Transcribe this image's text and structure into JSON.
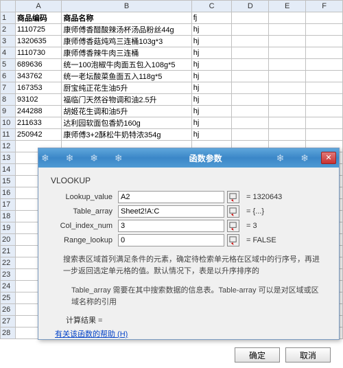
{
  "columns": [
    "",
    "A",
    "B",
    "C",
    "D",
    "E",
    "F"
  ],
  "headers": {
    "A": "商品编码",
    "B": "商品名称",
    "C": "fj"
  },
  "rows": [
    {
      "n": 1,
      "A": "",
      "B": "",
      "C": "fj"
    },
    {
      "n": 2,
      "A": "1110725",
      "B": "康师傅香醋酸辣汤杯汤品粉丝44g",
      "C": "hj"
    },
    {
      "n": 3,
      "A": "1320635",
      "B": "康师傅香菇炖鸡三连桶103g*3",
      "C": "hj"
    },
    {
      "n": 4,
      "A": "1110730",
      "B": "康师傅香辣牛肉三连桶",
      "C": "hj"
    },
    {
      "n": 5,
      "A": "689636",
      "B": "统一100泡椒牛肉面五包入108g*5",
      "C": "hj"
    },
    {
      "n": 6,
      "A": "343762",
      "B": "统一老坛酸菜鱼面五入118g*5",
      "C": "hj"
    },
    {
      "n": 7,
      "A": "167353",
      "B": "厨宝纯正花生油5升",
      "C": "hj"
    },
    {
      "n": 8,
      "A": "93102",
      "B": "福临门天然谷物调和油2.5升",
      "C": "hj"
    },
    {
      "n": 9,
      "A": "244288",
      "B": "胡姬花生调和油5升",
      "C": "hj"
    },
    {
      "n": 10,
      "A": "211633",
      "B": "达利园软面包香奶160g",
      "C": "hj"
    },
    {
      "n": 11,
      "A": "250942",
      "B": "康师傅3+2酥松牛奶特浓354g",
      "C": "hj"
    },
    {
      "n": 12
    },
    {
      "n": 13
    },
    {
      "n": 14
    },
    {
      "n": 15
    },
    {
      "n": 16
    },
    {
      "n": 17
    },
    {
      "n": 18
    },
    {
      "n": 19
    },
    {
      "n": 20
    },
    {
      "n": 21
    },
    {
      "n": 22
    },
    {
      "n": 23
    },
    {
      "n": 24
    },
    {
      "n": 25
    },
    {
      "n": 26
    },
    {
      "n": 27
    },
    {
      "n": 28
    }
  ],
  "dialog": {
    "title": "函数参数",
    "func": "VLOOKUP",
    "params": [
      {
        "label": "Lookup_value",
        "value": "A2",
        "result": "= 1320643"
      },
      {
        "label": "Table_array",
        "value": "Sheet2!A:C",
        "result": "= {...}"
      },
      {
        "label": "Col_index_num",
        "value": "3",
        "result": "= 3"
      },
      {
        "label": "Range_lookup",
        "value": "0",
        "result": "= FALSE"
      }
    ],
    "desc1": "搜索表区域首列满足条件的元素，确定待检索单元格在区域中的行序号，再进一步返回选定单元格的值。默认情况下，表是以升序排序的",
    "desc2": "Table_array    需要在其中搜索数据的信息表。Table-array 可以是对区域或区域名称的引用",
    "resultLabel": "计算结果 =",
    "helpLink": "有关该函数的帮助 (H)",
    "ok": "确定",
    "cancel": "取消"
  }
}
